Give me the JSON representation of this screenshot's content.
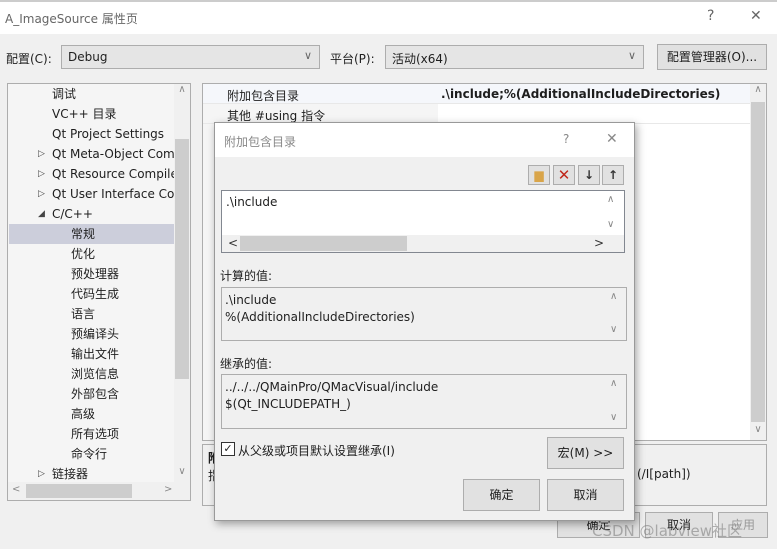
{
  "window": {
    "title": "A_ImageSource 属性页",
    "help": "?",
    "close": "✕"
  },
  "toolbar": {
    "config_label": "配置(C):",
    "config_value": "Debug",
    "platform_label": "平台(P):",
    "platform_value": "活动(x64)",
    "config_manager": "配置管理器(O)..."
  },
  "tree": {
    "items": [
      {
        "label": "调试",
        "level": 1
      },
      {
        "label": "VC++ 目录",
        "level": 1
      },
      {
        "label": "Qt Project Settings",
        "level": 1
      },
      {
        "label": "Qt Meta-Object Com",
        "level": 1,
        "arrow": "▷"
      },
      {
        "label": "Qt Resource Compile",
        "level": 1,
        "arrow": "▷"
      },
      {
        "label": "Qt User Interface Cor",
        "level": 1,
        "arrow": "▷"
      },
      {
        "label": "C/C++",
        "level": 1,
        "arrow": "◢"
      },
      {
        "label": "常规",
        "level": 2,
        "selected": true
      },
      {
        "label": "优化",
        "level": 2
      },
      {
        "label": "预处理器",
        "level": 2
      },
      {
        "label": "代码生成",
        "level": 2
      },
      {
        "label": "语言",
        "level": 2
      },
      {
        "label": "预编译头",
        "level": 2
      },
      {
        "label": "输出文件",
        "level": 2
      },
      {
        "label": "浏览信息",
        "level": 2
      },
      {
        "label": "外部包含",
        "level": 2
      },
      {
        "label": "高级",
        "level": 2
      },
      {
        "label": "所有选项",
        "level": 2
      },
      {
        "label": "命令行",
        "level": 2
      },
      {
        "label": "链接器",
        "level": 1,
        "arrow": "▷"
      }
    ]
  },
  "grid": {
    "rows": [
      {
        "name": "附加包含目录",
        "value": ".\\include;%(AdditionalIncludeDirectories)"
      },
      {
        "name": "其他 #using 指令",
        "value": ""
      }
    ]
  },
  "description": {
    "title": "附",
    "line": "指",
    "tail": "(/I[path])"
  },
  "footer": {
    "ok": "确定",
    "cancel": "取消",
    "apply": "应用"
  },
  "dialog": {
    "title": "附加包含目录",
    "help": "?",
    "close": "✕",
    "list_items": [
      ".\\include"
    ],
    "computed_label": "计算的值:",
    "computed_lines": [
      ".\\include",
      "%(AdditionalIncludeDirectories)"
    ],
    "inherited_label": "继承的值:",
    "inherited_lines": [
      "../../../QMainPro/QMacVisual/include",
      "$(Qt_INCLUDEPATH_)"
    ],
    "inherit_checkbox": "从父级或项目默认设置继承(I)",
    "inherit_checked": true,
    "macro_button": "宏(M) >>",
    "ok": "确定",
    "cancel": "取消"
  },
  "watermark": "CSDN @labview社区"
}
